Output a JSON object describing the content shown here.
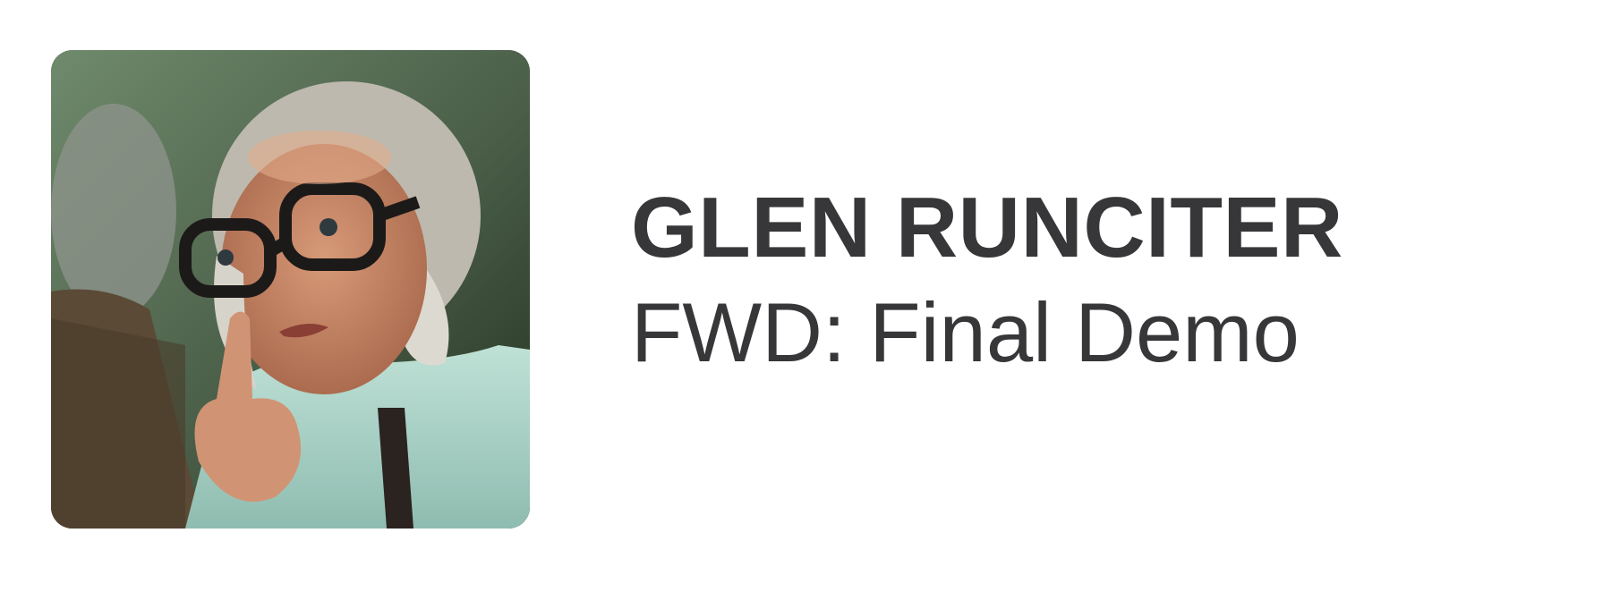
{
  "message": {
    "sender_name": "GLEN RUNCITER",
    "subject": "FWD: Final Demo"
  },
  "avatar": {
    "icon": "contact-photo",
    "colors": {
      "background": "#4f6a4e",
      "shirt": "#a9d2c6",
      "skin": "#c98a6b",
      "hair": "#c9c6bd",
      "glasses": "#1c1a19",
      "couch": "#5a4a36"
    }
  },
  "colors": {
    "text": "#37373a",
    "page_background": "#ffffff"
  }
}
